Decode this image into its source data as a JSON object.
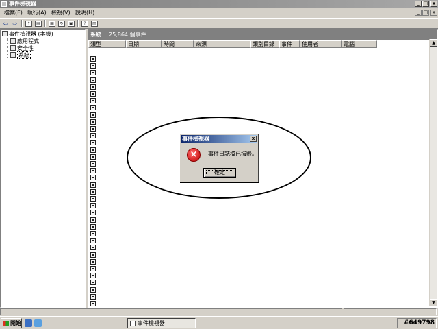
{
  "window": {
    "title": "事件檢視器"
  },
  "menu": [
    {
      "label": "檔案(F)"
    },
    {
      "label": "執行(A)"
    },
    {
      "label": "檢視(V)"
    },
    {
      "label": "說明(H)"
    }
  ],
  "tree": {
    "root": "事件檢視器 (本機)",
    "children": [
      "應用程式",
      "安全性",
      "系統"
    ],
    "selected": "系統"
  },
  "pane": {
    "name": "系統",
    "count": "25,864 個事件",
    "columns": [
      "類型",
      "日期",
      "時間",
      "來源",
      "類別目錄",
      "事件",
      "使用者",
      "電腦"
    ]
  },
  "dialog": {
    "title": "事件檢視器",
    "message": "事件日誌檔已損毀。",
    "ok_label": "確定",
    "close_glyph": "x"
  },
  "taskbar": {
    "start_label": "開始",
    "task_label": "事件檢視器",
    "tray_text": "#649798"
  },
  "colors": {
    "dialog_title_start": "#0a246a",
    "dialog_title_end": "#a6caf0",
    "error_red": "#c00000",
    "pane_header": "#808080"
  }
}
